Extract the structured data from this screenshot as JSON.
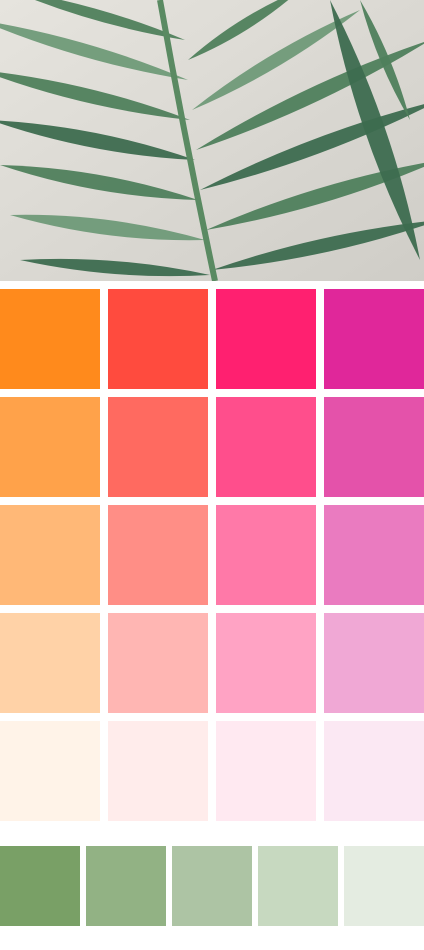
{
  "photo": {
    "subject": "palm-leaf",
    "palette": {
      "bg": "#cfcdc7",
      "bg_light": "#e6e4de",
      "leaf_dark": "#3d6b4f",
      "leaf_mid": "#4f7f5c",
      "leaf_light": "#6f9a78",
      "stem": "#5a8a62"
    }
  },
  "palette_rows": [
    [
      "#ff8a1c",
      "#ff4b3e",
      "#ff2070",
      "#e0279a"
    ],
    [
      "#ffa24a",
      "#ff6a60",
      "#ff4e8c",
      "#e452aa"
    ],
    [
      "#ffb877",
      "#ff8e86",
      "#ff79a8",
      "#ea7bc0"
    ],
    [
      "#ffd2a7",
      "#ffb6b3",
      "#ffa3c4",
      "#f0a8d5"
    ],
    [
      "#fff3e8",
      "#ffeceb",
      "#ffe9f1",
      "#fbe8f3"
    ]
  ],
  "green_row": [
    "#79a066",
    "#92b284",
    "#adc4a4",
    "#c7d9c0",
    "#e4ece1"
  ]
}
